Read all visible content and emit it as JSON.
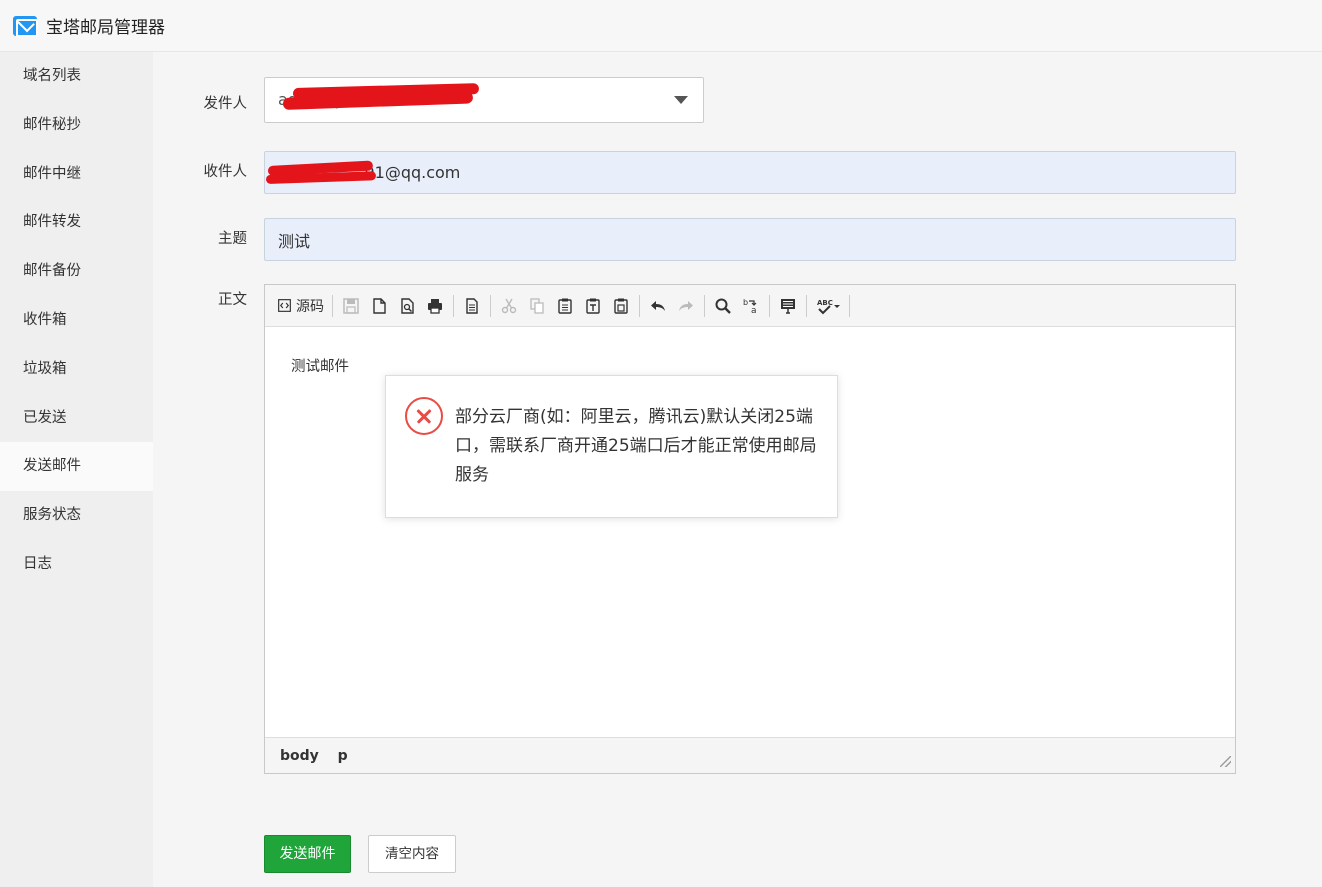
{
  "app": {
    "title": "宝塔邮局管理器"
  },
  "sidebar": {
    "items": [
      {
        "label": "域名列表"
      },
      {
        "label": "邮件秘抄"
      },
      {
        "label": "邮件中继"
      },
      {
        "label": "邮件转发"
      },
      {
        "label": "邮件备份"
      },
      {
        "label": "收件箱"
      },
      {
        "label": "垃圾箱"
      },
      {
        "label": "已发送"
      },
      {
        "label": "发送邮件",
        "active": true
      },
      {
        "label": "服务状态"
      },
      {
        "label": "日志"
      }
    ]
  },
  "form": {
    "sender_label": "发件人",
    "sender_value": "adm                       top",
    "recipient_label": "收件人",
    "recipient_value": "                 91@qq.com",
    "subject_label": "主题",
    "subject_value": "测试",
    "body_label": "正文",
    "body_text": "测试邮件",
    "toolbar": {
      "source_label": "源码"
    },
    "statusbar": {
      "path": [
        "body",
        "p"
      ]
    },
    "send_button": "发送邮件",
    "clear_button": "清空内容"
  },
  "dialog": {
    "message": "部分云厂商(如：阿里云，腾讯云)默认关闭25端口，需联系厂商开通25端口后才能正常使用邮局服务"
  },
  "colors": {
    "accent_green": "#20a53a",
    "error_red": "#e94b45",
    "input_bg": "#e8eefa"
  }
}
